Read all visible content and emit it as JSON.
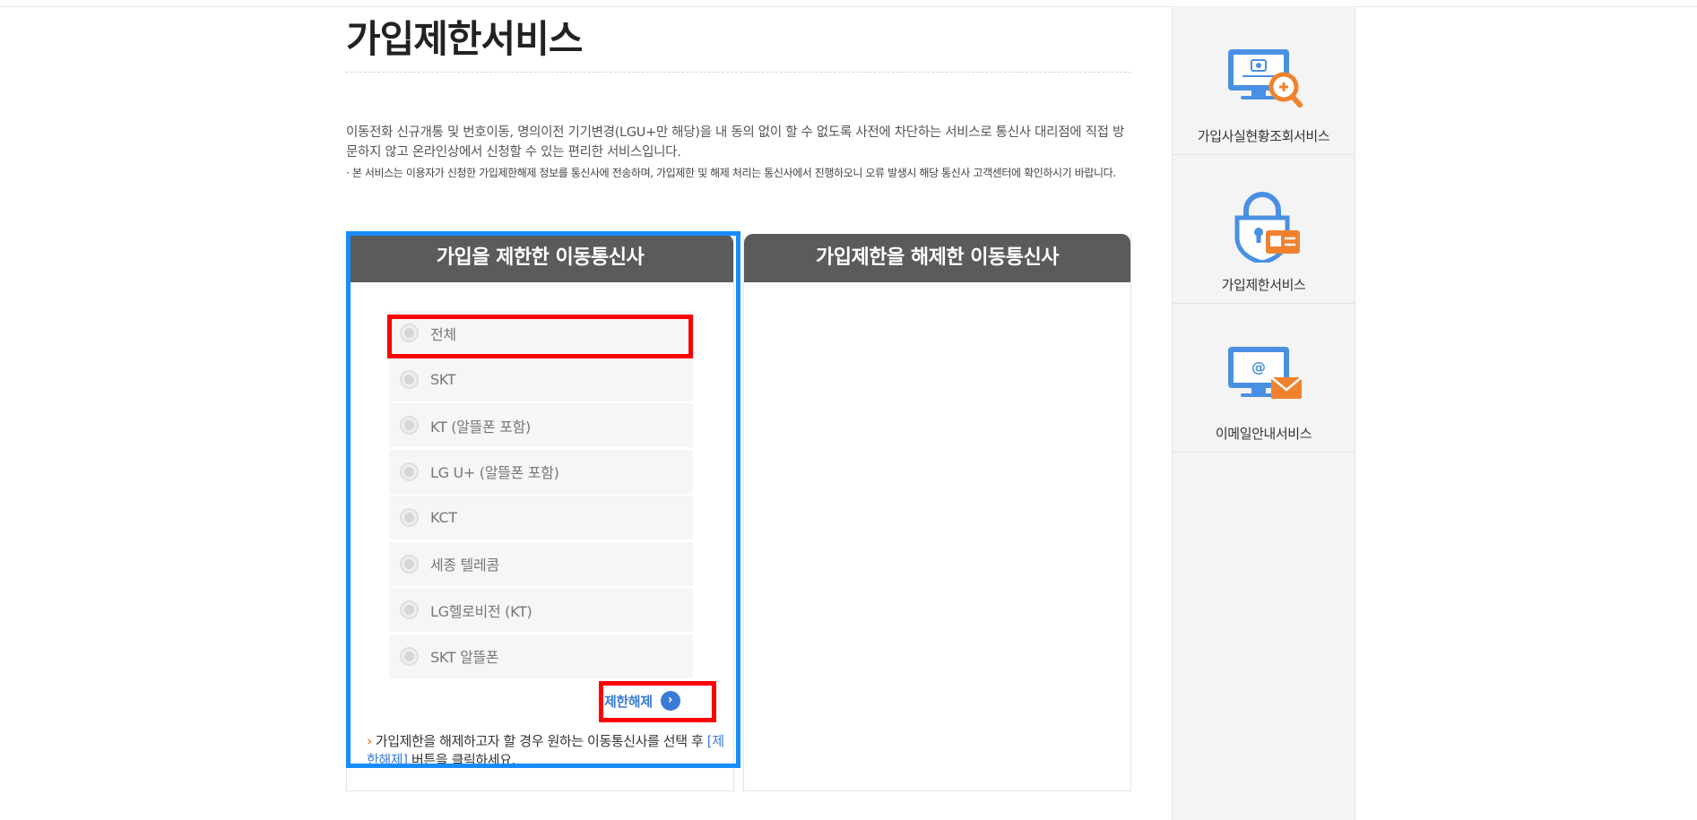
{
  "page": {
    "title": "가입제한서비스",
    "description": "이동전화 신규개통 및 번호이동, 명의이전 기기변경(LGU+만 해당)을 내 동의 없이 할 수 없도록 사전에 차단하는 서비스로 통신사 대리점에 직접 방문하지 않고 온라인상에서 신청할 수 있는 편리한 서비스입니다.",
    "notice": "· 본 서비스는 이용자가 신청한 가입제한해제 정보를 통신사에 전송하며, 가입제한 및 해제 처리는 통신사에서 진행하오니 오류 발생시 해당 통신사 고객센터에 확인하시기 바랍니다."
  },
  "left_panel": {
    "header": "가입을 제한한 이동통신사",
    "carriers": [
      {
        "label": "전체"
      },
      {
        "label": "SKT"
      },
      {
        "label": "KT (알뜰폰 포함)"
      },
      {
        "label": "LG U+ (알뜰폰 포함)"
      },
      {
        "label": "KCT"
      },
      {
        "label": "세종 텔레콤"
      },
      {
        "label": "LG헬로비전 (KT)"
      },
      {
        "label": "SKT 알뜰폰"
      }
    ],
    "release_button": "제한해제",
    "guide_arrow": "›",
    "guide_text": "가입제한을 해제하고자 할 경우 원하는 이동통신사를 선택 후",
    "guide_link": "[제한해제]",
    "guide_tail": "버튼을 클릭하세요."
  },
  "right_panel": {
    "header": "가입제한을 해제한 이동통신사"
  },
  "sidebar": {
    "items": [
      {
        "label": "가입사실현황조회서비스",
        "icon": "monitor-search-icon"
      },
      {
        "label": "가입제한서비스",
        "icon": "lock-id-card-icon"
      },
      {
        "label": "이메일안내서비스",
        "icon": "monitor-email-icon"
      }
    ]
  },
  "colors": {
    "panel_header": "#5c5b5b",
    "accent_blue": "#3a7bd5",
    "accent_orange": "#f0822e",
    "highlight_blue": "#1a8cff",
    "highlight_red": "#ff0000"
  }
}
